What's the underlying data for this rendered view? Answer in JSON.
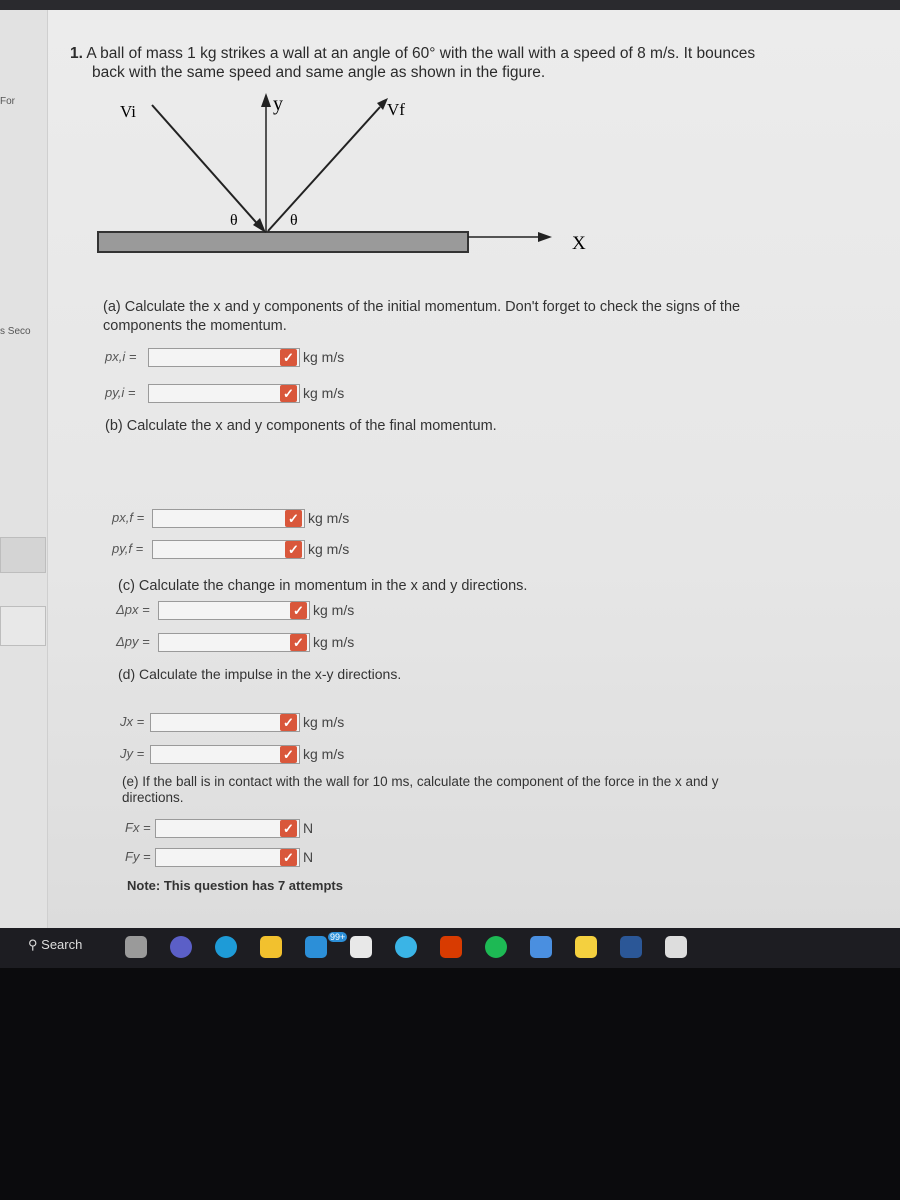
{
  "sidebar": {
    "items": [
      "For",
      "s Seco"
    ]
  },
  "question": {
    "number": "1.",
    "text_line1": "A ball of mass 1 kg strikes a wall at an angle of 60° with the wall with a speed of 8 m/s. It bounces",
    "text_line2": "back with the same speed and same angle as shown in the figure.",
    "figure": {
      "vi": "Vi",
      "vf": "Vf",
      "y": "y",
      "x": "X",
      "theta": "θ"
    }
  },
  "parts": {
    "a": {
      "text_line1": "(a) Calculate the x and y components of the initial momentum. Don't forget to check the signs of the",
      "text_line2": "components the momentum.",
      "fields": [
        {
          "label": "px,i =",
          "value": "",
          "unit": "kg m/s"
        },
        {
          "label": "py,i =",
          "value": "",
          "unit": "kg m/s"
        }
      ]
    },
    "b": {
      "text": "(b) Calculate the x and y components of the final momentum.",
      "fields": [
        {
          "label": "px,f =",
          "value": "",
          "unit": "kg m/s"
        },
        {
          "label": "py,f =",
          "value": "",
          "unit": "kg m/s"
        }
      ]
    },
    "c": {
      "text": "(c) Calculate the change in momentum in the x and y directions.",
      "fields": [
        {
          "label": "Δpx =",
          "value": "",
          "unit": "kg m/s"
        },
        {
          "label": "Δpy =",
          "value": "",
          "unit": "kg m/s"
        }
      ]
    },
    "d": {
      "text": "(d) Calculate the impulse in the x-y directions.",
      "fields": [
        {
          "label": "Jx =",
          "value": "",
          "unit": "kg m/s"
        },
        {
          "label": "Jy =",
          "value": "",
          "unit": "kg m/s"
        }
      ]
    },
    "e": {
      "text_line1": "(e) If the ball is in contact with the wall for 10 ms, calculate the component of the force in the x and y",
      "text_line2": "directions.",
      "fields": [
        {
          "label": "Fx =",
          "value": "",
          "unit": "N"
        },
        {
          "label": "Fy =",
          "value": "",
          "unit": "N"
        }
      ]
    }
  },
  "note": "Note: This question has 7 attempts",
  "check_icon": "✓",
  "check_color": "#d9573b",
  "taskbar": {
    "search_label": "Search",
    "mail_badge": "99+",
    "apps": [
      "task-view",
      "teams-meet",
      "edge",
      "file-explorer",
      "mail",
      "store",
      "cortana",
      "office",
      "spotify",
      "calendar",
      "sticky-notes",
      "word",
      "snipping-tool"
    ]
  }
}
